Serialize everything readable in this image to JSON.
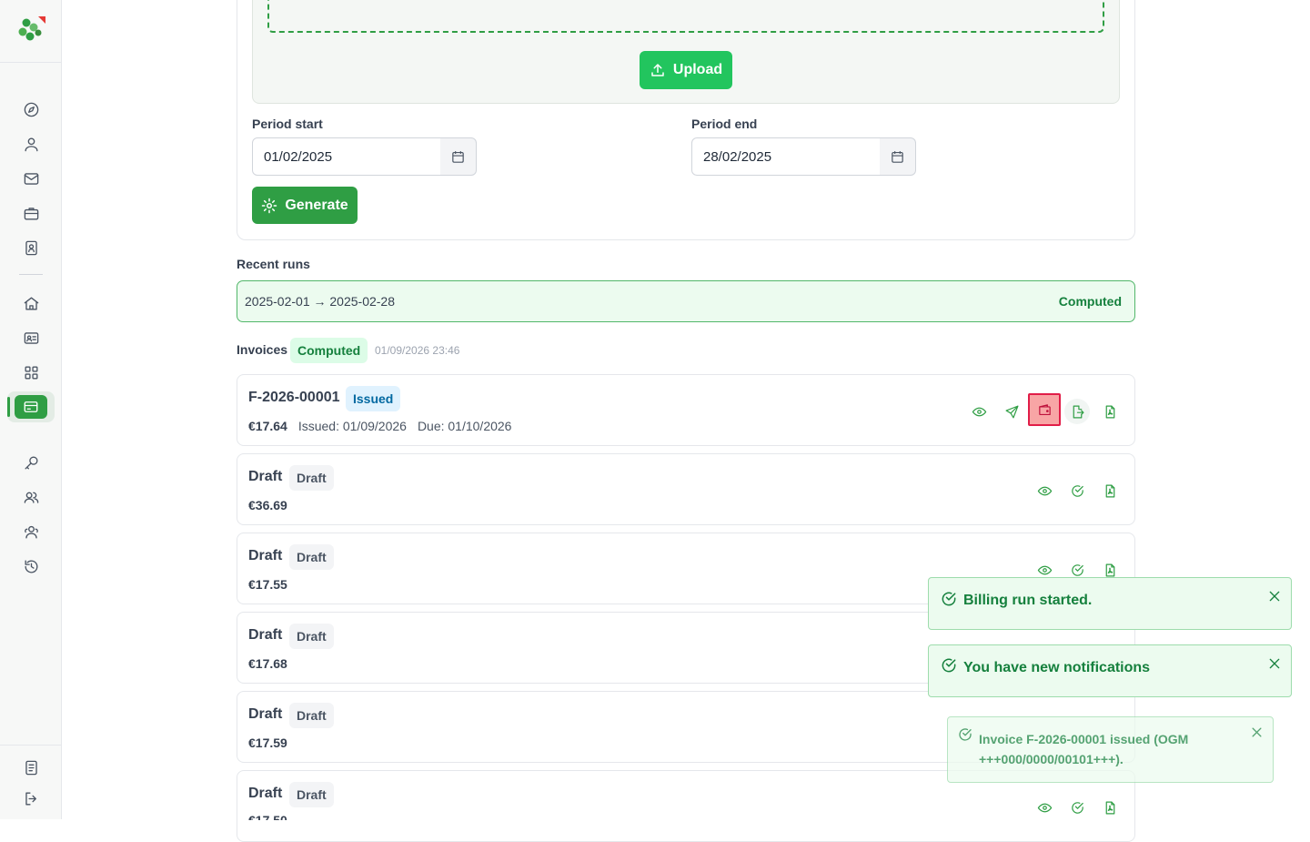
{
  "sidebar": {
    "logo": "app-logo",
    "nav_icons": [
      "compass-icon",
      "user-icon",
      "mail-icon",
      "briefcase-icon",
      "contact-book-icon",
      "home-icon",
      "id-card-icon",
      "grid-icon",
      "billing-icon",
      "key-icon",
      "users-icon",
      "group-icon",
      "history-icon"
    ],
    "footer_icons": [
      "document-icon",
      "logout-icon"
    ]
  },
  "upload": {
    "button_label": "Upload"
  },
  "period": {
    "start_label": "Period start",
    "start_value": "01/02/2025",
    "end_label": "Period end",
    "end_value": "28/02/2025"
  },
  "generate": {
    "button_label": "Generate"
  },
  "recent_runs": {
    "label": "Recent runs",
    "runs": [
      {
        "range": "2025-02-01 → 2025-02-28",
        "status": "Computed"
      }
    ]
  },
  "invoices": {
    "label": "Invoices",
    "status": "Computed",
    "timestamp": "01/09/2026 23:46",
    "items": [
      {
        "title": "F-2026-00001",
        "status": "Issued",
        "amount": "€17.64",
        "issued": "Issued: 01/09/2026",
        "due": "Due: 01/10/2026"
      },
      {
        "title": "Draft",
        "status": "Draft",
        "amount": "€36.69"
      },
      {
        "title": "Draft",
        "status": "Draft",
        "amount": "€17.55"
      },
      {
        "title": "Draft",
        "status": "Draft",
        "amount": "€17.68"
      },
      {
        "title": "Draft",
        "status": "Draft",
        "amount": "€17.59"
      },
      {
        "title": "Draft",
        "status": "Draft",
        "amount": "€17.50"
      }
    ]
  },
  "toasts": [
    {
      "text": "Billing run started."
    },
    {
      "text": "You have new notifications"
    },
    {
      "text_line1": "Invoice F-2026-00001 issued (OGM",
      "text_line2": "+++000/0000/00101+++)."
    }
  ],
  "colors": {
    "primary": "#2f9e44",
    "accent": "#22c55e",
    "highlight": "#e11d48",
    "issued_badge": "#0369a1"
  }
}
